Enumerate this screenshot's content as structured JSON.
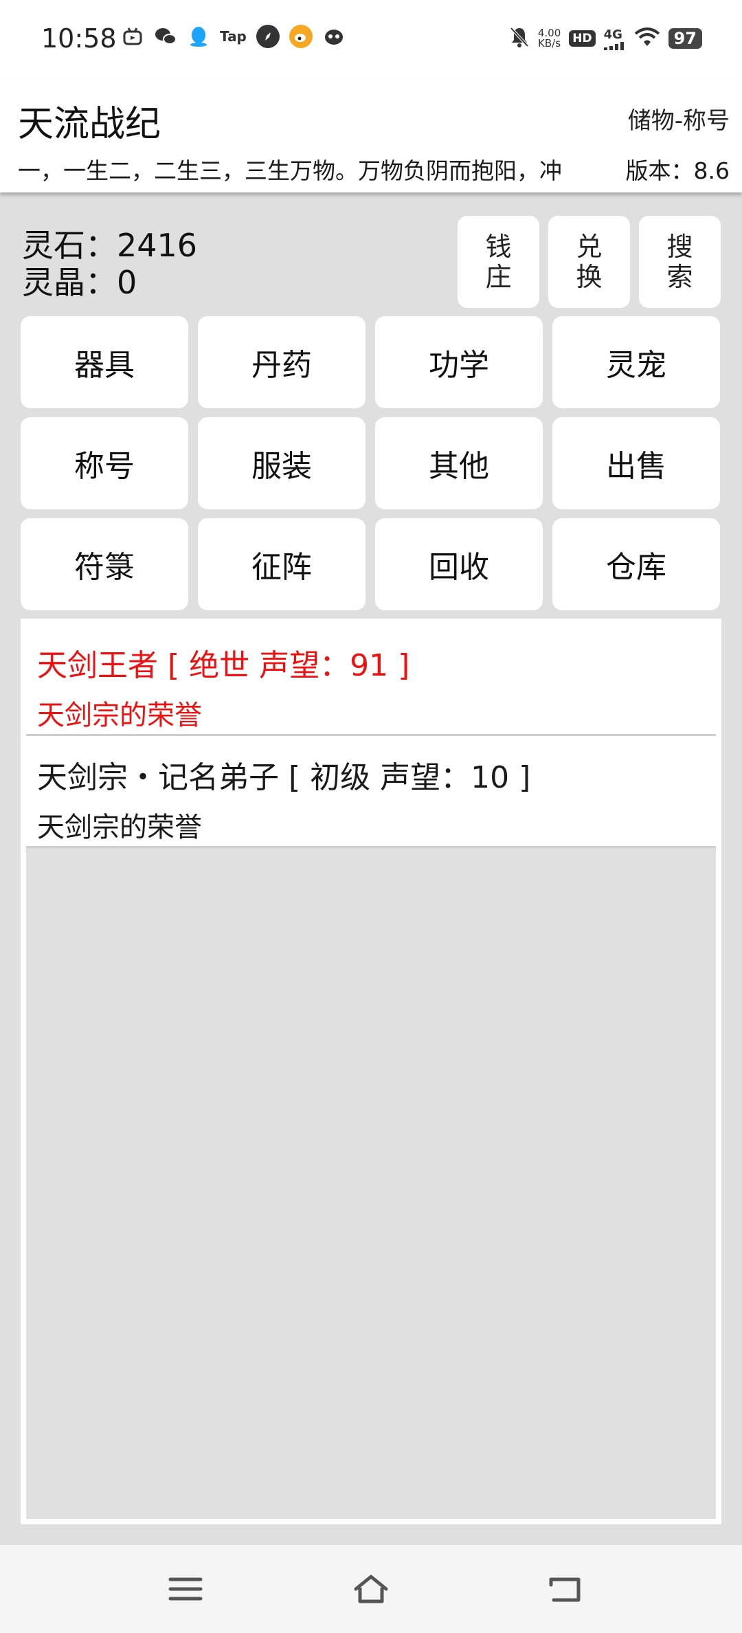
{
  "status_bar": {
    "time": "10:58",
    "left_icons": [
      "bilibili-icon",
      "wechat-icon",
      "qq-icon",
      "taptap-icon",
      "compass-icon",
      "weibo-icon",
      "game-icon"
    ],
    "tap_label": "Tap",
    "net_speed_value": "4.00",
    "net_speed_unit": "KB/s",
    "hd_label": "HD",
    "network_label": "4G",
    "battery": "97"
  },
  "app": {
    "title": "天流战纪",
    "subtitle": "储物-称号",
    "marquee": "一，一生二，二生三，三生万物。万物负阴而抱阳，冲",
    "version": "版本：8.6"
  },
  "currency": {
    "stone": "灵石：2416",
    "crystal": "灵晶：0"
  },
  "quick_buttons": [
    "钱庄",
    "兑换",
    "搜索"
  ],
  "categories": [
    "器具",
    "丹药",
    "功学",
    "灵宠",
    "称号",
    "服装",
    "其他",
    "出售",
    "符箓",
    "征阵",
    "回收",
    "仓库"
  ],
  "titles": [
    {
      "name": "天剑王者 [ 绝世 声望：91 ]",
      "desc": "天剑宗的荣誉",
      "color": "#ee1111"
    },
    {
      "name": "天剑宗・记名弟子 [ 初级 声望：10 ]",
      "desc": "天剑宗的荣誉",
      "color": "#1a1a1a"
    }
  ],
  "nav": [
    "menu-icon",
    "home-icon",
    "back-icon"
  ]
}
